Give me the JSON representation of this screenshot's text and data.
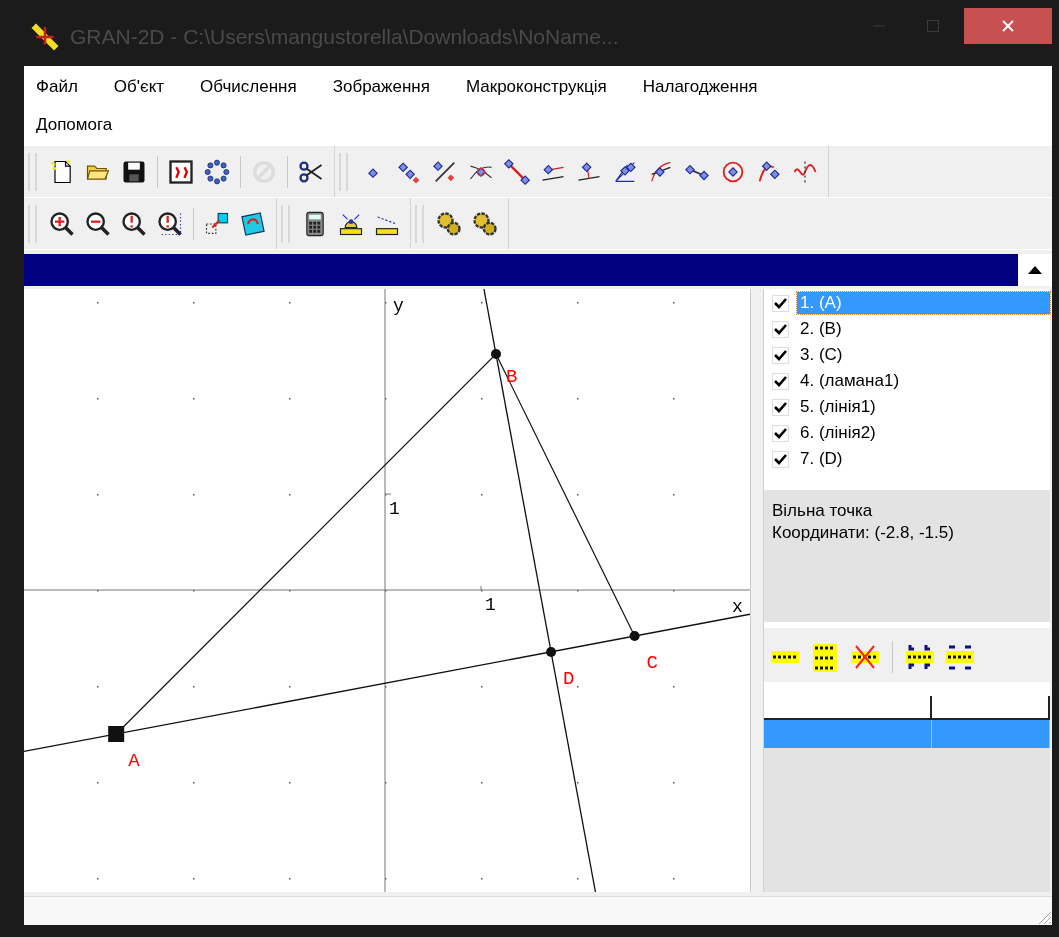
{
  "window": {
    "title": "GRAN-2D - C:\\Users\\mangustorella\\Downloads\\NoName..."
  },
  "menu": [
    "Файл",
    "Об'єкт",
    "Обчислення",
    "Зображення",
    "Макроконструкція",
    "Налагодження",
    "Допомога"
  ],
  "toolbars": [
    {
      "buttons": [
        {
          "disabled": false
        },
        {
          "disabled": false
        },
        {
          "disabled": false
        },
        {
          "disabled": false
        },
        {
          "disabled": false
        },
        {
          "disabled": true
        },
        {
          "disabled": false
        }
      ]
    },
    {
      "buttons": [
        {
          "disabled": false
        },
        {
          "disabled": false
        },
        {
          "disabled": false
        },
        {
          "disabled": false
        },
        {
          "disabled": false
        },
        {
          "disabled": false
        },
        {
          "disabled": false
        },
        {
          "disabled": false
        },
        {
          "disabled": false
        },
        {
          "disabled": false
        },
        {
          "disabled": false
        },
        {
          "disabled": false
        },
        {
          "disabled": false
        }
      ]
    },
    {
      "buttons": [
        {
          "disabled": false
        },
        {
          "disabled": false
        },
        {
          "disabled": false
        },
        {
          "disabled": false
        },
        {
          "disabled": false
        },
        {
          "disabled": false
        }
      ]
    },
    {
      "buttons": [
        {
          "disabled": false
        },
        {
          "disabled": false
        },
        {
          "disabled": false
        }
      ]
    },
    {
      "buttons": [
        {
          "disabled": false
        },
        {
          "disabled": false
        }
      ]
    }
  ],
  "canvas": {
    "axes": {
      "x_label": "x",
      "y_label": "y",
      "x_tick": "1",
      "y_tick": "1"
    },
    "points": [
      {
        "label": "A",
        "selected": true
      },
      {
        "label": "B",
        "selected": false
      },
      {
        "label": "C",
        "selected": false
      },
      {
        "label": "D",
        "selected": false
      }
    ]
  },
  "objects": [
    {
      "label": "1.  (A)",
      "checked": true,
      "selected": true
    },
    {
      "label": "2.  (B)",
      "checked": true,
      "selected": false
    },
    {
      "label": "3.  (C)",
      "checked": true,
      "selected": false
    },
    {
      "label": "4.  (ламана1)",
      "checked": true,
      "selected": false
    },
    {
      "label": "5.  (лінія1)",
      "checked": true,
      "selected": false
    },
    {
      "label": "6.  (лінія2)",
      "checked": true,
      "selected": false
    },
    {
      "label": "7.  (D)",
      "checked": true,
      "selected": false
    }
  ],
  "info": [
    "Вільна точка",
    "Координати: (-2.8, -1.5)"
  ],
  "table": {
    "rows": [
      {
        "selected": true
      }
    ]
  }
}
